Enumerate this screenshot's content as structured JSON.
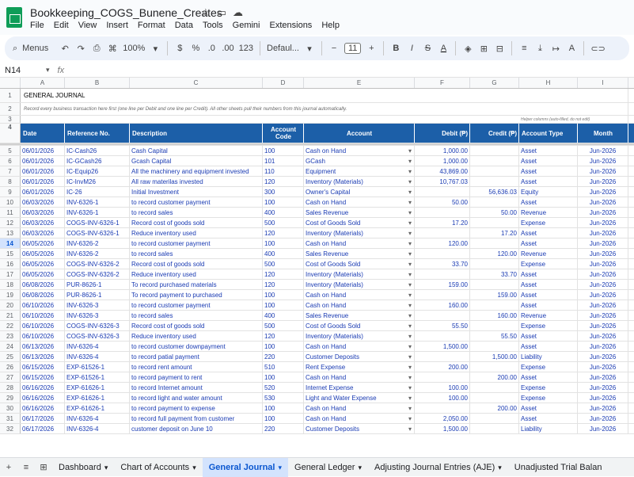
{
  "app": {
    "title": "Bookkeeping_COGS_Bunene_Creates",
    "menus": [
      "File",
      "Edit",
      "View",
      "Insert",
      "Format",
      "Data",
      "Tools",
      "Gemini",
      "Extensions",
      "Help"
    ]
  },
  "toolbar": {
    "search_label": "Menus",
    "zoom": "100%",
    "currency": "$",
    "percent": "%",
    "dec_decrease": ".0",
    "dec_increase": ".00",
    "number_format": "123",
    "font": "Defaul...",
    "font_size": "11",
    "minus": "−",
    "plus": "+",
    "bold": "B",
    "italic": "I",
    "strike": "S",
    "text_color": "A"
  },
  "formula_bar": {
    "cell_ref": "N14",
    "fx": "fx"
  },
  "columns": [
    "A",
    "B",
    "C",
    "D",
    "E",
    "F",
    "G",
    "H",
    "I"
  ],
  "sheet": {
    "title": "GENERAL JOURNAL",
    "instructions": "Record every business transaction here first (one line per Debit and one line per Credit). All other sheets pull their numbers from this journal automatically.",
    "helper_note": "Helper columns (auto-filled, do not edit)",
    "headers": [
      "Date",
      "Reference No.",
      "Description",
      "Account Code",
      "Account",
      "Debit (₱)",
      "Credit (₱)",
      "Account Type",
      "Month"
    ],
    "rows": [
      [
        "06/01/2026",
        "IC-Cash26",
        "Cash Capital",
        "100",
        "Cash on Hand",
        "1,000.00",
        "",
        "Asset",
        "Jun-2026"
      ],
      [
        "06/01/2026",
        "IC-GCash26",
        "Gcash Capital",
        "101",
        "GCash",
        "1,000.00",
        "",
        "Asset",
        "Jun-2026"
      ],
      [
        "06/01/2026",
        "IC-Equip26",
        "All the machinery and equipment invested",
        "110",
        "Equipment",
        "43,869.00",
        "",
        "Asset",
        "Jun-2026"
      ],
      [
        "06/01/2026",
        "IC-InvM26",
        "All raw materilas invested",
        "120",
        "Inventory (Materials)",
        "10,767.03",
        "",
        "Asset",
        "Jun-2026"
      ],
      [
        "06/01/2026",
        "IC-26",
        "Initial Investment",
        "300",
        "Owner's Capital",
        "",
        "56,636.03",
        "Equity",
        "Jun-2026"
      ],
      [
        "06/03/2026",
        "INV-6326-1",
        "to record customer payment",
        "100",
        "Cash on Hand",
        "50.00",
        "",
        "Asset",
        "Jun-2026"
      ],
      [
        "06/03/2026",
        "INV-6326-1",
        "to record sales",
        "400",
        "Sales Revenue",
        "",
        "50.00",
        "Revenue",
        "Jun-2026"
      ],
      [
        "06/03/2026",
        "COGS-INV-6326-1",
        "Record cost of goods sold",
        "500",
        "Cost of Goods Sold",
        "17.20",
        "",
        "Expense",
        "Jun-2026"
      ],
      [
        "06/03/2026",
        "COGS-INV-6326-1",
        "Reduce inventory used",
        "120",
        "Inventory (Materials)",
        "",
        "17.20",
        "Asset",
        "Jun-2026"
      ],
      [
        "06/05/2026",
        "INV-6326-2",
        "to record customer payment",
        "100",
        "Cash on Hand",
        "120.00",
        "",
        "Asset",
        "Jun-2026"
      ],
      [
        "06/05/2026",
        "INV-6326-2",
        "to record sales",
        "400",
        "Sales Revenue",
        "",
        "120.00",
        "Revenue",
        "Jun-2026"
      ],
      [
        "06/05/2026",
        "COGS-INV-6326-2",
        "Record cost of goods sold",
        "500",
        "Cost of Goods Sold",
        "33.70",
        "",
        "Expense",
        "Jun-2026"
      ],
      [
        "06/05/2026",
        "COGS-INV-6326-2",
        "Reduce inventory used",
        "120",
        "Inventory (Materials)",
        "",
        "33.70",
        "Asset",
        "Jun-2026"
      ],
      [
        "06/08/2026",
        "PUR-8626-1",
        "To record purchased materials",
        "120",
        "Inventory (Materials)",
        "159.00",
        "",
        "Asset",
        "Jun-2026"
      ],
      [
        "06/08/2026",
        "PUR-8626-1",
        "To record payment to purchased",
        "100",
        "Cash on Hand",
        "",
        "159.00",
        "Asset",
        "Jun-2026"
      ],
      [
        "06/10/2026",
        "INV-6326-3",
        "to record customer payment",
        "100",
        "Cash on Hand",
        "160.00",
        "",
        "Asset",
        "Jun-2026"
      ],
      [
        "06/10/2026",
        "INV-6326-3",
        "to record sales",
        "400",
        "Sales Revenue",
        "",
        "160.00",
        "Revenue",
        "Jun-2026"
      ],
      [
        "06/10/2026",
        "COGS-INV-6326-3",
        "Record cost of goods sold",
        "500",
        "Cost of Goods Sold",
        "55.50",
        "",
        "Expense",
        "Jun-2026"
      ],
      [
        "06/10/2026",
        "COGS-INV-6326-3",
        "Reduce inventory used",
        "120",
        "Inventory (Materials)",
        "",
        "55.50",
        "Asset",
        "Jun-2026"
      ],
      [
        "06/13/2026",
        "INV-6326-4",
        "to record customer downpayment",
        "100",
        "Cash on Hand",
        "1,500.00",
        "",
        "Asset",
        "Jun-2026"
      ],
      [
        "06/13/2026",
        "INV-6326-4",
        "to record patial payment",
        "220",
        "Customer Deposits",
        "",
        "1,500.00",
        "Liability",
        "Jun-2026"
      ],
      [
        "06/15/2026",
        "EXP-61526-1",
        "to record rent amount",
        "510",
        "Rent Expense",
        "200.00",
        "",
        "Expense",
        "Jun-2026"
      ],
      [
        "06/15/2026",
        "EXP-61526-1",
        "to record payment to rent",
        "100",
        "Cash on Hand",
        "",
        "200.00",
        "Asset",
        "Jun-2026"
      ],
      [
        "06/16/2026",
        "EXP-61626-1",
        "to record Internet amount",
        "520",
        "Internet Expense",
        "100.00",
        "",
        "Expense",
        "Jun-2026"
      ],
      [
        "06/16/2026",
        "EXP-61626-1",
        "to record light and water amount",
        "530",
        "Light and Water Expense",
        "100.00",
        "",
        "Expense",
        "Jun-2026"
      ],
      [
        "06/16/2026",
        "EXP-61626-1",
        "to record payment to expense",
        "100",
        "Cash on Hand",
        "",
        "200.00",
        "Asset",
        "Jun-2026"
      ],
      [
        "06/17/2026",
        "INV-6326-4",
        "to record full payment from customer",
        "100",
        "Cash on Hand",
        "2,050.00",
        "",
        "Asset",
        "Jun-2026"
      ],
      [
        "06/17/2026",
        "INV-6326-4",
        "customer deposit on June 10",
        "220",
        "Customer Deposits",
        "1,500.00",
        "",
        "Liability",
        "Jun-2026"
      ]
    ]
  },
  "tabs": [
    "Dashboard",
    "Chart of Accounts",
    "General Journal",
    "General Ledger",
    "Adjusting Journal Entries (AJE)",
    "Unadjusted Trial Balan"
  ],
  "active_tab": "General Journal"
}
